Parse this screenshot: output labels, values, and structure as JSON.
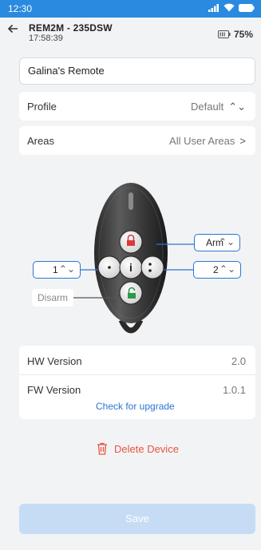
{
  "status": {
    "time": "12:30"
  },
  "header": {
    "device_name": "REM2M - 235DSW",
    "device_time": "17:58:39",
    "battery": "75%"
  },
  "remote_name": "Galina's Remote",
  "profile": {
    "label": "Profile",
    "value": "Default"
  },
  "areas": {
    "label": "Areas",
    "value": "All User Areas"
  },
  "buttons": {
    "top": "Arm",
    "left": "1",
    "right": "2",
    "bottom": "Disarm"
  },
  "versions": {
    "hw_label": "HW Version",
    "hw_value": "2.0",
    "fw_label": "FW Version",
    "fw_value": "1.0.1",
    "upgrade_link": "Check for upgrade"
  },
  "delete_label": "Delete Device",
  "save_label": "Save",
  "colors": {
    "accent": "#2a76d2",
    "status_bar": "#2a8ae0",
    "delete": "#e8553e",
    "save_disabled": "#c6dcf5"
  }
}
